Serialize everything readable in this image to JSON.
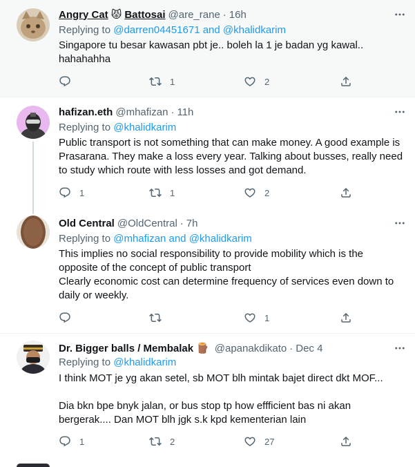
{
  "tweets": [
    {
      "name": "Angry Cat",
      "name_suffix": "Battosai",
      "emoji": "😾",
      "handle": "@are_rane",
      "time": "16h",
      "replying_prefix": "Replying to",
      "mentions": [
        "@darren04451671",
        "and",
        "@khalidkarim"
      ],
      "lines": [
        "Singapore tu besar kawasan pbt je.. boleh la 1 je badan yg kawal..",
        "hahahahha"
      ],
      "reply_count": "",
      "retweet_count": "1",
      "like_count": "2"
    },
    {
      "name": "hafizan.eth",
      "handle": "@mhafizan",
      "time": "11h",
      "replying_prefix": "Replying to",
      "mentions": [
        "@khalidkarim"
      ],
      "lines": [
        "Public transport is not something that can make money. A good example is",
        "Prasarana. They make a loss every year. Talking about busses, really need",
        "to study which route with less losses and got demand."
      ],
      "reply_count": "1",
      "retweet_count": "1",
      "like_count": "2"
    },
    {
      "name": "Old Central",
      "handle": "@OldCentral",
      "time": "7h",
      "replying_prefix": "Replying to",
      "mentions": [
        "@mhafizan",
        "and",
        "@khalidkarim"
      ],
      "lines": [
        "This implies no social responsibility to provide mobility which is the",
        "opposite of the concept of public transport",
        "Clearly economic cost can determine frequency of services even down to",
        "daily or weekly."
      ],
      "reply_count": "",
      "retweet_count": "",
      "like_count": "1"
    },
    {
      "name": "Dr. Bigger balls / Membalak",
      "emoji": "🪵",
      "handle": "@apanakdikato",
      "time": "Dec 4",
      "replying_prefix": "Replying to",
      "mentions": [
        "@khalidkarim"
      ],
      "lines": [
        "I think MOT je yg akan setel, sb MOT blh mintak bajet direct dkt MOF...",
        "",
        "Dia bkn bpe bnyk jalan, or bus stop tp how effficient bas ni akan",
        "bergerak.... Dan MOT blh jgk s.k kpd kementerian lain"
      ],
      "reply_count": "1",
      "retweet_count": "2",
      "like_count": "27"
    }
  ],
  "separator": "·",
  "colors": {
    "link": "#1d9bf0",
    "muted": "#536471",
    "text": "#0f1419",
    "thread": "#cfd9de"
  }
}
